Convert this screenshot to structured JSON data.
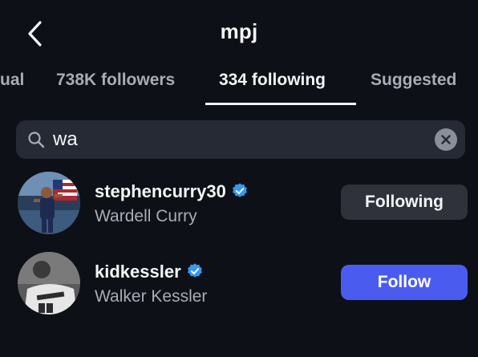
{
  "header": {
    "title": "mpj"
  },
  "tabs": [
    {
      "label": "ual"
    },
    {
      "label": "738K followers"
    },
    {
      "label": "334 following"
    },
    {
      "label": "Suggested"
    }
  ],
  "search": {
    "value": "wa"
  },
  "results": [
    {
      "username": "stephencurry30",
      "name": "Wardell Curry",
      "verified": true,
      "button_label": "Following"
    },
    {
      "username": "kidkessler",
      "name": "Walker Kessler",
      "verified": true,
      "button_label": "Follow"
    }
  ],
  "colors": {
    "background": "#0e1017",
    "follow_button": "#4a5cf0",
    "following_button": "#2f323a",
    "verified_badge": "#3897f0"
  },
  "icons": [
    "back-arrow-icon",
    "search-icon",
    "clear-icon",
    "verified-badge-icon"
  ]
}
